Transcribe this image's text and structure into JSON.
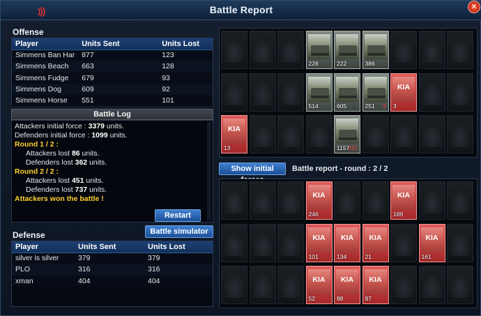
{
  "window": {
    "title": "Battle Report",
    "close": "✕"
  },
  "offense": {
    "title": "Offense",
    "columns": [
      "Player",
      "Units Sent",
      "Units Lost"
    ],
    "rows": [
      [
        "Simmens Ban Har",
        "877",
        "123"
      ],
      [
        "Simmens Beach",
        "663",
        "128"
      ],
      [
        "Simmens Fudge",
        "679",
        "93"
      ],
      [
        "Simmens Dog",
        "609",
        "92"
      ],
      [
        "Simmens Horse",
        "551",
        "101"
      ]
    ]
  },
  "battle_log": {
    "title": "Battle Log",
    "line1_text": "Attackers initial force : ",
    "line1_value": "3379",
    "line1_suffix": " units.",
    "line2_text": "Defenders initial force : ",
    "line2_value": "1099",
    "line2_suffix": " units.",
    "round1": "Round 1 / 2 :",
    "r1_att_text": "Attackers lost ",
    "r1_att_value": "86",
    "r1_att_suffix": " units.",
    "r1_def_text": "Defenders lost ",
    "r1_def_value": "362",
    "r1_def_suffix": " units.",
    "round2": "Round 2 / 2 :",
    "r2_att_text": "Attackers lost ",
    "r2_att_value": "451",
    "r2_att_suffix": " units.",
    "r2_def_text": "Defenders lost ",
    "r2_def_value": "737",
    "r2_def_suffix": " units.",
    "result": "Attackers won the battle !",
    "restart": "Restart"
  },
  "battle_simulator": "Battle simulator",
  "defense": {
    "title": "Defense",
    "columns": [
      "Player",
      "Units Sent",
      "Units Lost"
    ],
    "rows": [
      [
        "silver is silver",
        "379",
        "379"
      ],
      [
        "PLO",
        "316",
        "316"
      ],
      [
        "xman",
        "404",
        "404"
      ]
    ]
  },
  "show_initial": "Show initial forces",
  "round_label": "Battle report - round : 2 / 2",
  "kia": "KIA",
  "attacker_grid": {
    "cells": [
      {
        "type": "empty"
      },
      {
        "type": "empty"
      },
      {
        "type": "empty"
      },
      {
        "type": "unit",
        "num": "228",
        "lost": ""
      },
      {
        "type": "unit",
        "num": "222",
        "lost": ""
      },
      {
        "type": "unit",
        "num": "386",
        "lost": ""
      },
      {
        "type": "empty"
      },
      {
        "type": "empty"
      },
      {
        "type": "empty"
      },
      {
        "type": "empty"
      },
      {
        "type": "empty"
      },
      {
        "type": "empty"
      },
      {
        "type": "unit",
        "num": "514",
        "lost": ""
      },
      {
        "type": "unit",
        "num": "605",
        "lost": ""
      },
      {
        "type": "unit",
        "num": "251",
        "lost": "3"
      },
      {
        "type": "kia",
        "num": "3",
        "lost": ""
      },
      {
        "type": "empty"
      },
      {
        "type": "empty"
      },
      {
        "type": "kia",
        "num": "13",
        "lost": ""
      },
      {
        "type": "empty"
      },
      {
        "type": "empty"
      },
      {
        "type": "empty"
      },
      {
        "type": "unit",
        "num": "1157",
        "lost": "521"
      },
      {
        "type": "empty"
      },
      {
        "type": "empty"
      },
      {
        "type": "empty"
      },
      {
        "type": "empty"
      }
    ]
  },
  "defender_grid": {
    "cells": [
      {
        "type": "empty"
      },
      {
        "type": "empty"
      },
      {
        "type": "empty"
      },
      {
        "type": "kia",
        "num": "246",
        "lost": ""
      },
      {
        "type": "empty"
      },
      {
        "type": "empty"
      },
      {
        "type": "kia",
        "num": "189",
        "lost": ""
      },
      {
        "type": "empty"
      },
      {
        "type": "empty"
      },
      {
        "type": "empty"
      },
      {
        "type": "empty"
      },
      {
        "type": "empty"
      },
      {
        "type": "kia",
        "num": "101",
        "lost": ""
      },
      {
        "type": "kia",
        "num": "134",
        "lost": ""
      },
      {
        "type": "kia",
        "num": "21",
        "lost": ""
      },
      {
        "type": "empty"
      },
      {
        "type": "kia",
        "num": "161",
        "lost": ""
      },
      {
        "type": "empty"
      },
      {
        "type": "empty"
      },
      {
        "type": "empty"
      },
      {
        "type": "empty"
      },
      {
        "type": "kia",
        "num": "52",
        "lost": ""
      },
      {
        "type": "kia",
        "num": "98",
        "lost": ""
      },
      {
        "type": "kia",
        "num": "97",
        "lost": ""
      },
      {
        "type": "empty"
      },
      {
        "type": "empty"
      },
      {
        "type": "empty"
      }
    ]
  }
}
